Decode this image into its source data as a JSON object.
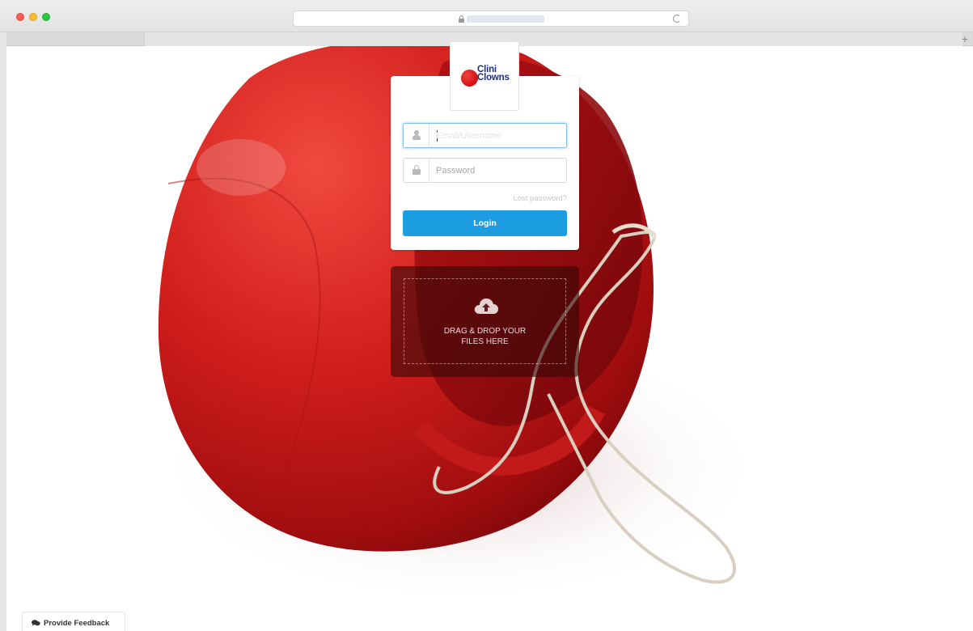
{
  "browser": {
    "window_controls": [
      "close",
      "minimize",
      "maximize"
    ],
    "address_icon": "lock-icon",
    "reload_icon": "reload-icon",
    "new_tab_label": "+"
  },
  "brand": {
    "logo_line1": "Clini",
    "logo_line2": "Clowns",
    "logo_text_color": "#1c2f8c",
    "logo_ball_color": "#d10e0e"
  },
  "login": {
    "username_placeholder": "Email/Username",
    "username_value": "",
    "username_icon": "user-icon",
    "password_placeholder": "Password",
    "password_value": "",
    "password_icon": "lock-icon",
    "lost_password_label": "Lost password?",
    "submit_label": "Login",
    "accent_color": "#1c9de2"
  },
  "dropzone": {
    "icon": "cloud-upload-icon",
    "line1": "DRAG & DROP YOUR",
    "line2": "FILES HERE"
  },
  "feedback": {
    "icon": "chat-icon",
    "label": "Provide Feedback"
  },
  "background": {
    "subject": "red clown nose",
    "primary_color": "#c8191b"
  }
}
